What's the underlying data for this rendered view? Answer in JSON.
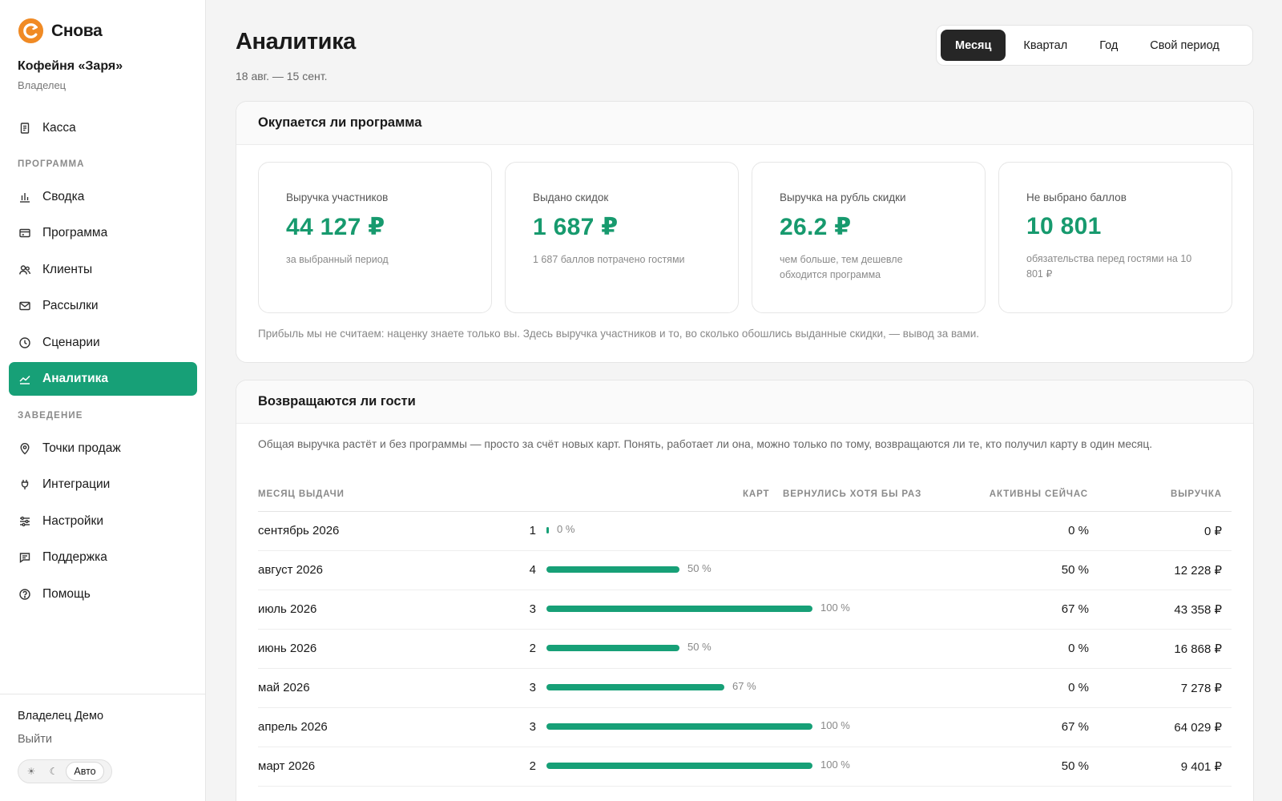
{
  "brand": {
    "name": "Снова",
    "accent": "#17a077",
    "logo_color": "#f08a24"
  },
  "venue": {
    "name": "Кофейня «Заря»",
    "role": "Владелец"
  },
  "nav": {
    "top_items": [
      {
        "label": "Касса",
        "icon": "receipt-icon"
      }
    ],
    "sections": [
      {
        "title": "ПРОГРАММА",
        "items": [
          {
            "label": "Сводка",
            "icon": "bar-chart-icon"
          },
          {
            "label": "Программа",
            "icon": "card-icon"
          },
          {
            "label": "Клиенты",
            "icon": "users-icon"
          },
          {
            "label": "Рассылки",
            "icon": "mail-icon"
          },
          {
            "label": "Сценарии",
            "icon": "clock-icon"
          },
          {
            "label": "Аналитика",
            "icon": "trend-icon",
            "active": true
          }
        ]
      },
      {
        "title": "ЗАВЕДЕНИЕ",
        "items": [
          {
            "label": "Точки продаж",
            "icon": "map-pin-icon"
          },
          {
            "label": "Интеграции",
            "icon": "plug-icon"
          },
          {
            "label": "Настройки",
            "icon": "sliders-icon"
          },
          {
            "label": "Поддержка",
            "icon": "chat-icon"
          },
          {
            "label": "Помощь",
            "icon": "help-circle-icon"
          }
        ]
      }
    ]
  },
  "footer": {
    "user": "Владелец Демо",
    "logout": "Выйти",
    "theme": {
      "light": "☀",
      "dark": "☾",
      "auto": "Авто",
      "selected": "Авто"
    }
  },
  "header": {
    "title": "Аналитика",
    "range": "18 авг. — 15 сент.",
    "periods": [
      "Месяц",
      "Квартал",
      "Год",
      "Свой период"
    ],
    "active_period": "Месяц"
  },
  "payback": {
    "title": "Окупается ли программа",
    "metrics": [
      {
        "label": "Выручка участников",
        "value": "44 127 ₽",
        "sub": "за выбранный период"
      },
      {
        "label": "Выдано скидок",
        "value": "1 687 ₽",
        "sub": "1 687 баллов потрачено гостями"
      },
      {
        "label": "Выручка на рубль скидки",
        "value": "26.2 ₽",
        "sub": "чем больше, тем дешевле обходится программа"
      },
      {
        "label": "Не выбрано баллов",
        "value": "10 801",
        "sub": "обязательства перед гостями на 10 801 ₽"
      }
    ],
    "note": "Прибыль мы не считаем: наценку знаете только вы. Здесь выручка участников и то, во сколько обошлись выданные скидки, — вывод за вами."
  },
  "retention": {
    "title": "Возвращаются ли гости",
    "intro": "Общая выручка растёт и без программы — просто за счёт новых карт. Понять, работает ли она, можно только по тому, возвращаются ли те, кто получил карту в один месяц.",
    "columns": {
      "month": "МЕСЯЦ ВЫДАЧИ",
      "cards": "КАРТ",
      "returned": "ВЕРНУЛИСЬ ХОТЯ БЫ РАЗ",
      "active": "АКТИВНЫ СЕЙЧАС",
      "revenue": "ВЫРУЧКА"
    },
    "rows": [
      {
        "month": "сентябрь 2026",
        "cards": "1",
        "returned_pct": 0,
        "returned_label": "0 %",
        "active": "0 %",
        "revenue": "0 ₽"
      },
      {
        "month": "август 2026",
        "cards": "4",
        "returned_pct": 50,
        "returned_label": "50 %",
        "active": "50 %",
        "revenue": "12 228 ₽"
      },
      {
        "month": "июль 2026",
        "cards": "3",
        "returned_pct": 100,
        "returned_label": "100 %",
        "active": "67 %",
        "revenue": "43 358 ₽"
      },
      {
        "month": "июнь 2026",
        "cards": "2",
        "returned_pct": 50,
        "returned_label": "50 %",
        "active": "0 %",
        "revenue": "16 868 ₽"
      },
      {
        "month": "май 2026",
        "cards": "3",
        "returned_pct": 67,
        "returned_label": "67 %",
        "active": "0 %",
        "revenue": "7 278 ₽"
      },
      {
        "month": "апрель 2026",
        "cards": "3",
        "returned_pct": 100,
        "returned_label": "100 %",
        "active": "67 %",
        "revenue": "64 029 ₽"
      },
      {
        "month": "март 2026",
        "cards": "2",
        "returned_pct": 100,
        "returned_label": "100 %",
        "active": "50 %",
        "revenue": "9 401 ₽"
      }
    ]
  }
}
